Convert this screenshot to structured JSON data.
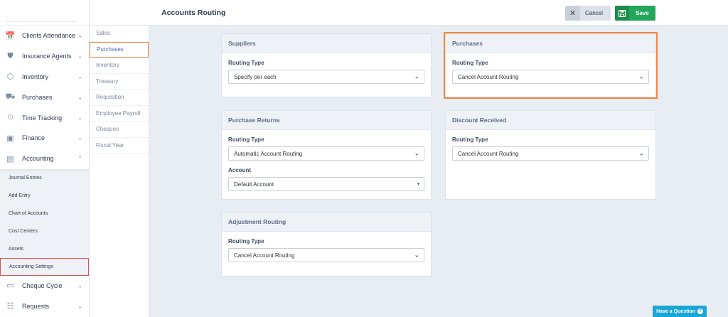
{
  "header": {
    "title": "Accounts Routing",
    "cancel_label": "Cancel",
    "save_label": "Save"
  },
  "sidebar": {
    "items_top": [
      {
        "label": "Clients Attendance",
        "icon": "calendar-icon"
      },
      {
        "label": "Insurance Agents",
        "icon": "shield-icon"
      },
      {
        "label": "Inventory",
        "icon": "box-icon"
      },
      {
        "label": "Purchases",
        "icon": "truck-icon"
      },
      {
        "label": "Time Tracking",
        "icon": "clock-icon"
      },
      {
        "label": "Finance",
        "icon": "money-icon"
      },
      {
        "label": "Accounting",
        "icon": "accounting-icon"
      }
    ],
    "sub_items": [
      "Journal Entries",
      "Add Entry",
      "Chart of Accounts",
      "Cost Centers",
      "Assets",
      "Accounting Settings"
    ],
    "items_bottom": [
      {
        "label": "Cheque Cycle",
        "icon": "cheque-icon"
      },
      {
        "label": "Requests",
        "icon": "clipboard-icon"
      }
    ]
  },
  "subnav": [
    "Sales",
    "Purchases",
    "Inventory",
    "Treasury",
    "Requisition",
    "Employee Payroll",
    "Cheques",
    "Fiscal Year"
  ],
  "cards": {
    "suppliers": {
      "title": "Suppliers",
      "routing_label": "Routing Type",
      "routing_value": "Specify per each"
    },
    "purchases": {
      "title": "Purchases",
      "routing_label": "Routing Type",
      "routing_value": "Cancel Account Routing"
    },
    "purchase_returns": {
      "title": "Purchase Returns",
      "routing_label": "Routing Type",
      "routing_value": "Automatic Account Routing",
      "account_label": "Account",
      "account_value": "Default Account"
    },
    "discount_received": {
      "title": "Discount Received",
      "routing_label": "Routing Type",
      "routing_value": "Cancel Account Routing"
    },
    "adjustment_routing": {
      "title": "Adjustment Routing",
      "routing_label": "Routing Type",
      "routing_value": "Cancel Account Routing"
    }
  },
  "help": {
    "label": "Have a Question"
  },
  "colors": {
    "accent_orange": "#f0873d",
    "save_green": "#23a65a",
    "help_blue": "#19a6d8",
    "active_red": "#d9534f"
  }
}
